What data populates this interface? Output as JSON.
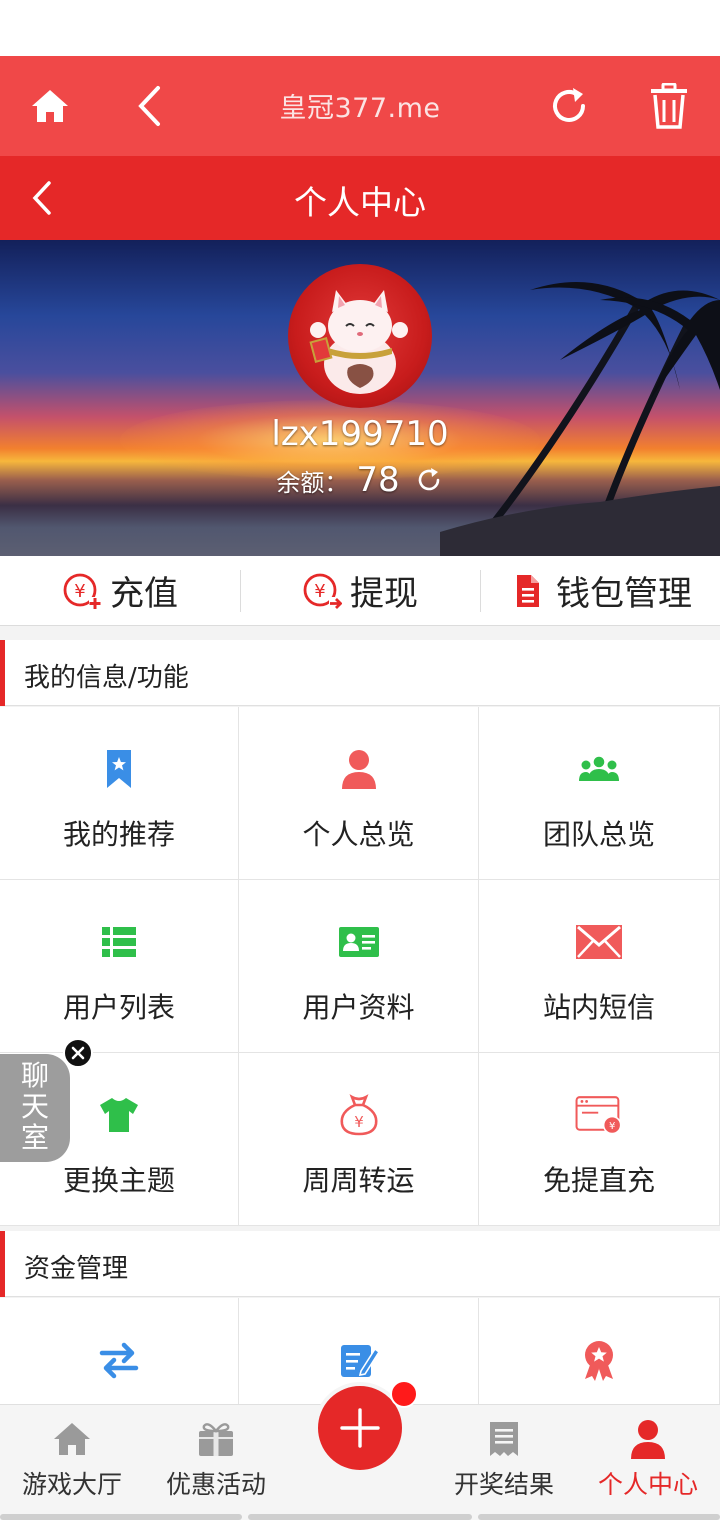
{
  "browser": {
    "title": "皇冠377.me"
  },
  "header": {
    "title": "个人中心"
  },
  "profile": {
    "username": "lzx199710",
    "balance_label": "余额：",
    "balance_value": "78"
  },
  "actions": [
    {
      "label": "充值",
      "icon": "yuan-plus-icon"
    },
    {
      "label": "提现",
      "icon": "yuan-out-icon"
    },
    {
      "label": "钱包管理",
      "icon": "document-icon"
    }
  ],
  "sections": {
    "info": {
      "title": "我的信息/功能",
      "items": [
        {
          "label": "我的推荐",
          "icon": "bookmark-star-icon",
          "color": "#3a8ee6"
        },
        {
          "label": "个人总览",
          "icon": "person-icon",
          "color": "#f05a5a"
        },
        {
          "label": "团队总览",
          "icon": "team-icon",
          "color": "#2fbf4a"
        },
        {
          "label": "用户列表",
          "icon": "list-icon",
          "color": "#2fbf4a"
        },
        {
          "label": "用户资料",
          "icon": "id-card-icon",
          "color": "#2fbf4a"
        },
        {
          "label": "站内短信",
          "icon": "envelope-icon",
          "color": "#f05a5a"
        },
        {
          "label": "更换主题",
          "icon": "tshirt-icon",
          "color": "#2fbf4a"
        },
        {
          "label": "周周转运",
          "icon": "money-bag-icon",
          "color": "#f05a5a"
        },
        {
          "label": "免提直充",
          "icon": "browser-yuan-icon",
          "color": "#f05a5a"
        }
      ]
    },
    "funds": {
      "title": "资金管理",
      "items": [
        {
          "label": "",
          "icon": "transfer-arrows-icon",
          "color": "#3a8ee6"
        },
        {
          "label": "",
          "icon": "edit-form-icon",
          "color": "#3a8ee6"
        },
        {
          "label": "",
          "icon": "medal-icon",
          "color": "#f05a5a"
        }
      ]
    }
  },
  "chat": {
    "label": "聊天室"
  },
  "tabs": [
    {
      "label": "游戏大厅",
      "icon": "home-icon"
    },
    {
      "label": "优惠活动",
      "icon": "gift-icon"
    },
    {
      "label": "开奖结果",
      "icon": "receipt-icon"
    },
    {
      "label": "个人中心",
      "icon": "person-icon",
      "active": true
    }
  ],
  "colors": {
    "header_red": "#e52828",
    "browser_red": "#f04848",
    "accent_blue": "#3a8ee6",
    "accent_green": "#2fbf4a"
  }
}
